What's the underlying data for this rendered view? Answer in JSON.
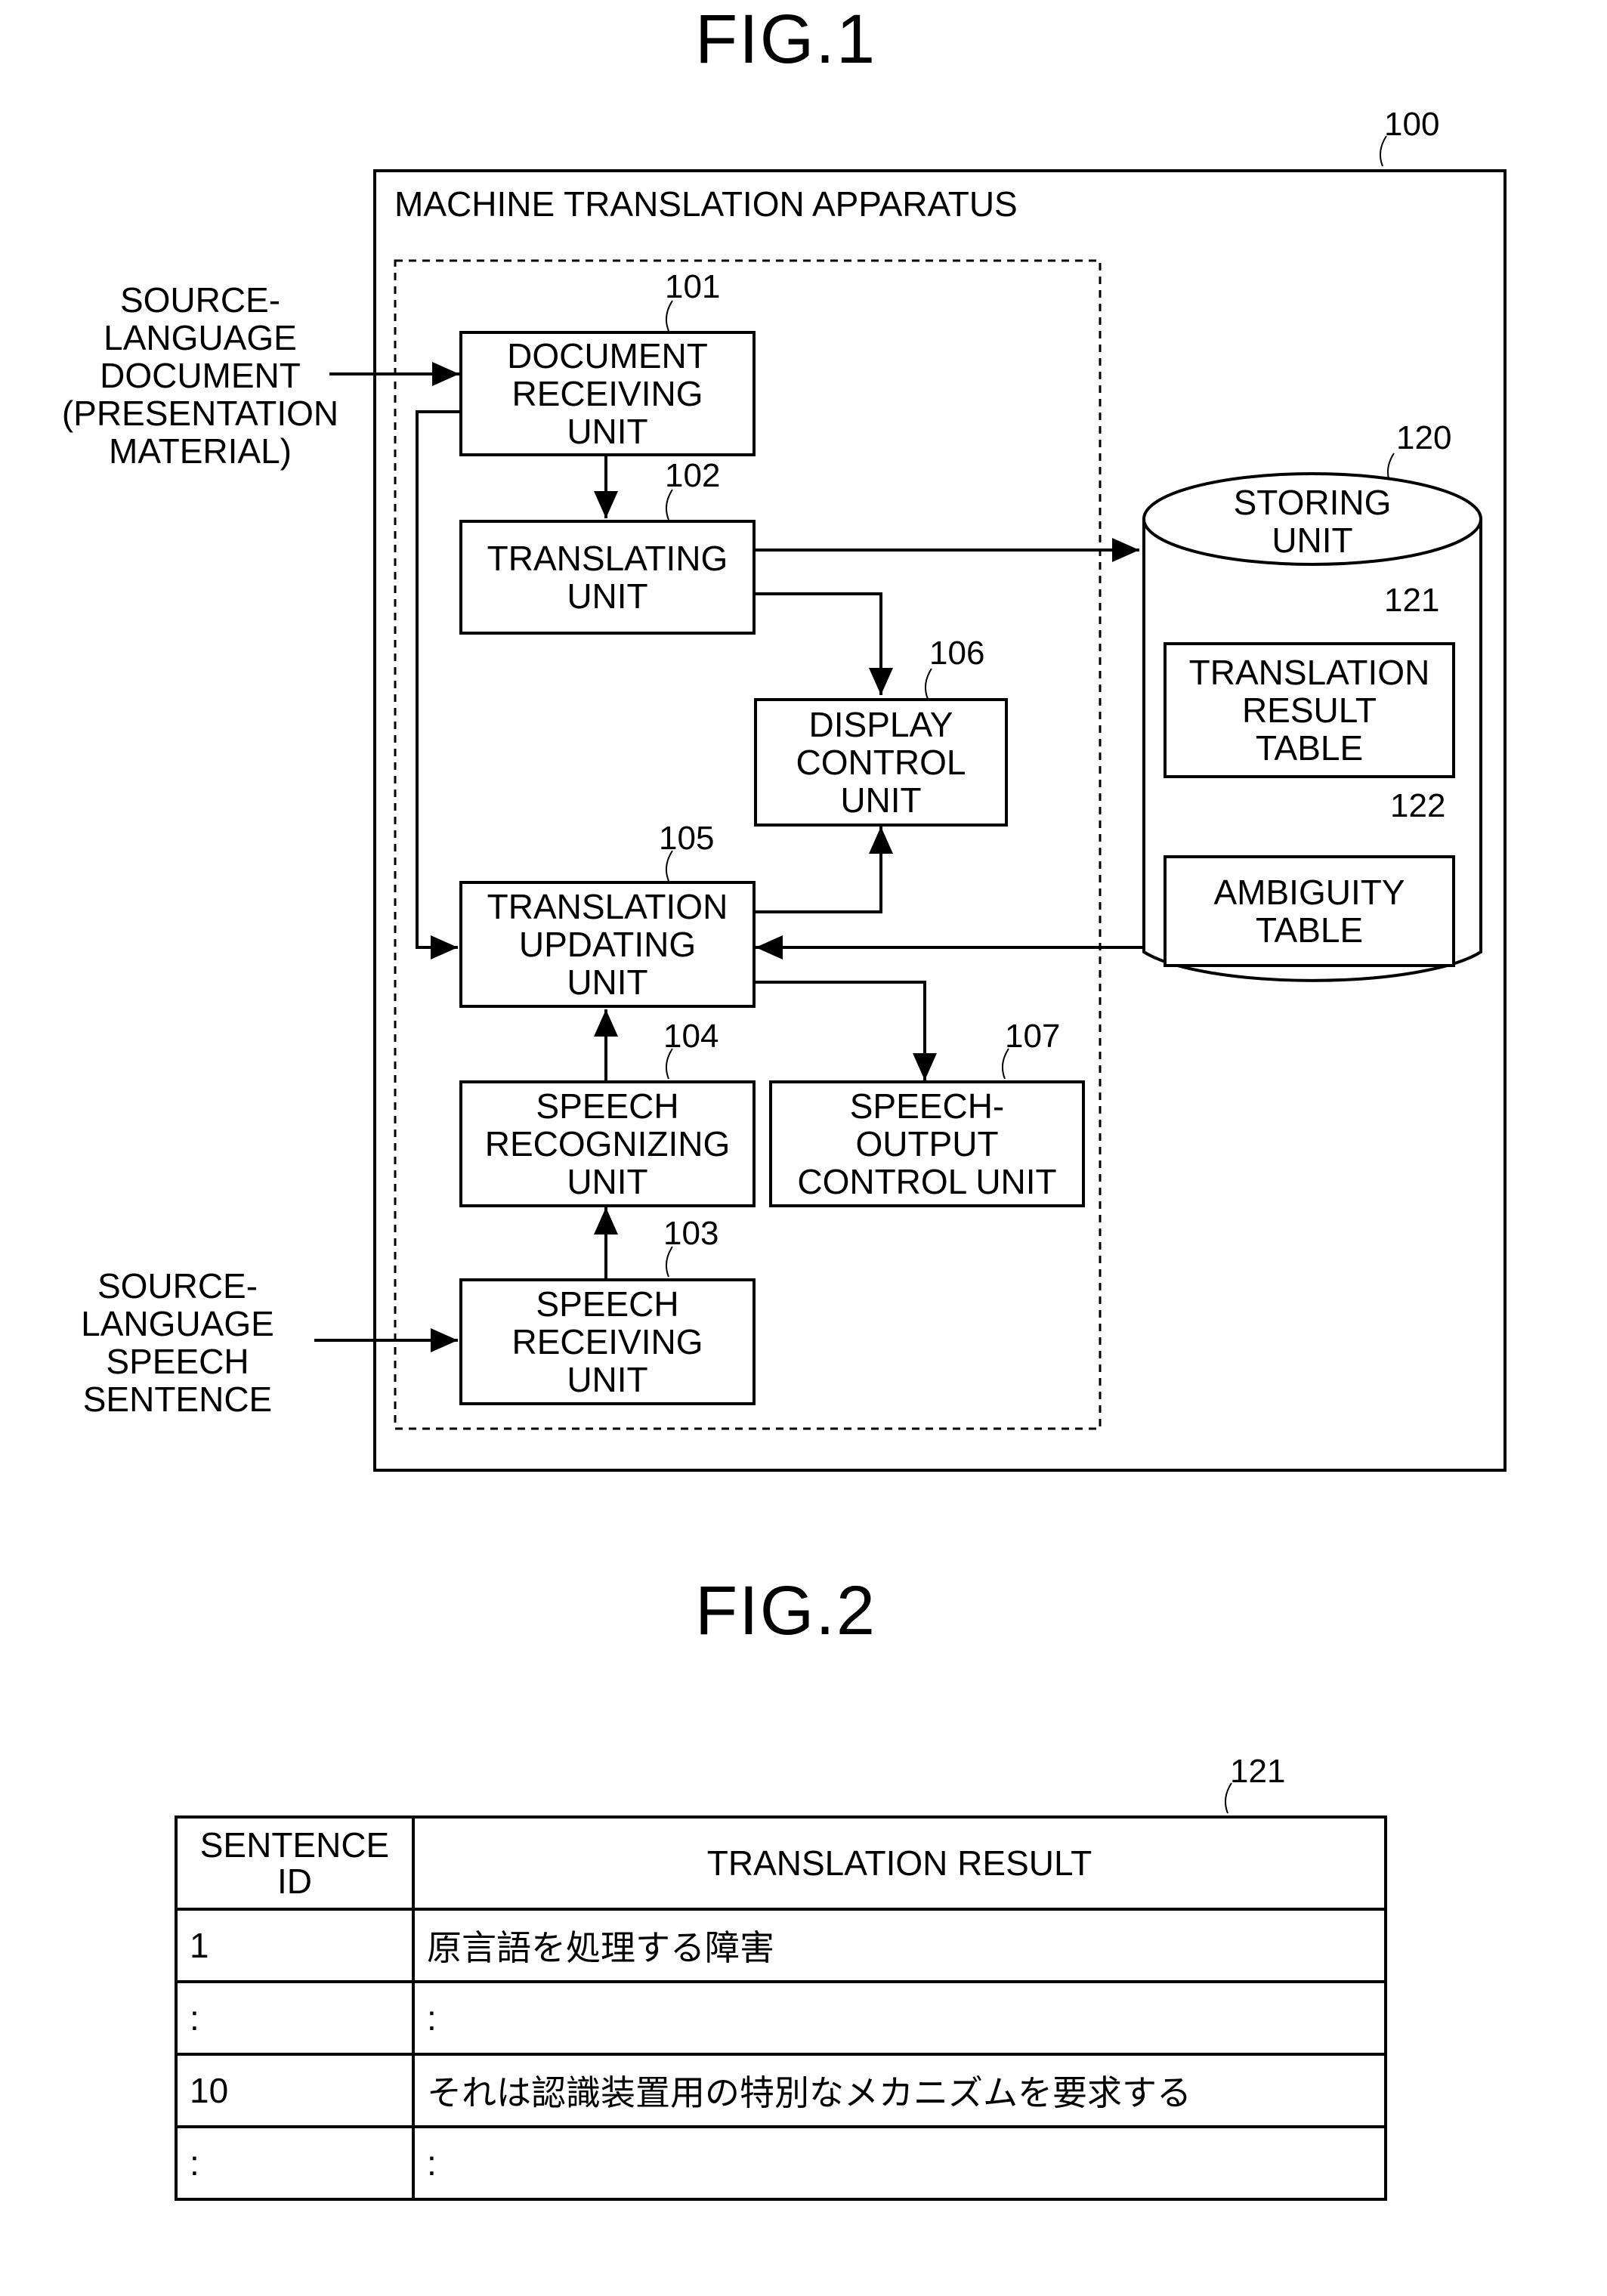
{
  "fig1": {
    "title": "FIG.1",
    "apparatus": {
      "ref": "100",
      "label": "MACHINE TRANSLATION APPARATUS"
    },
    "inputs": {
      "document": "SOURCE-\nLANGUAGE\nDOCUMENT\n(PRESENTATION\nMATERIAL)",
      "speech": "SOURCE-\nLANGUAGE\nSPEECH\nSENTENCE"
    },
    "units": {
      "document_receiving": {
        "ref": "101",
        "label": "DOCUMENT\nRECEIVING\nUNIT"
      },
      "translating": {
        "ref": "102",
        "label": "TRANSLATING\nUNIT"
      },
      "speech_receiving": {
        "ref": "103",
        "label": "SPEECH\nRECEIVING\nUNIT"
      },
      "speech_recognizing": {
        "ref": "104",
        "label": "SPEECH\nRECOGNIZING\nUNIT"
      },
      "translation_updating": {
        "ref": "105",
        "label": "TRANSLATION\nUPDATING\nUNIT"
      },
      "display_control": {
        "ref": "106",
        "label": "DISPLAY\nCONTROL\nUNIT"
      },
      "speech_output_control": {
        "ref": "107",
        "label": "SPEECH-\nOUTPUT\nCONTROL UNIT"
      }
    },
    "storage": {
      "ref": "120",
      "label": "STORING\nUNIT",
      "translation_result_table": {
        "ref": "121",
        "label": "TRANSLATION\nRESULT\nTABLE"
      },
      "ambiguity_table": {
        "ref": "122",
        "label": "AMBIGUITY\nTABLE"
      }
    }
  },
  "fig2": {
    "title": "FIG.2",
    "ref": "121",
    "columns": [
      "SENTENCE\nID",
      "TRANSLATION RESULT"
    ],
    "rows": [
      [
        "1",
        "原言語を処理する障害"
      ],
      [
        ":",
        ":"
      ],
      [
        "10",
        "それは認識装置用の特別なメカニズムを要求する"
      ],
      [
        ":",
        ":"
      ]
    ]
  }
}
